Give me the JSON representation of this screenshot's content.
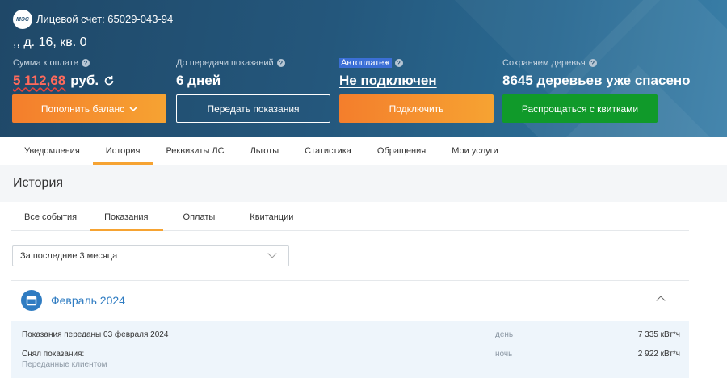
{
  "header": {
    "logo_text": "МЭС",
    "account_label": "Лицевой счет: 65029-043-94",
    "address": ",, д. 16, кв. 0",
    "balance": {
      "label": "Сумма к оплате",
      "amount": "5 112,68",
      "currency": "руб."
    },
    "meter_deadline": {
      "label": "До передачи показаний",
      "value": "6 дней"
    },
    "autopay": {
      "label": "Автоплатеж",
      "value": "Не подключен"
    },
    "trees": {
      "label": "Сохраняем деревья",
      "value": "8645 деревьев уже спасено"
    }
  },
  "buttons": {
    "topup": "Пополнить баланс",
    "submit_readings": "Передать показания",
    "connect": "Подключить",
    "opt_out_receipts": "Распрощаться с квитками"
  },
  "nav": [
    "Уведомления",
    "История",
    "Реквизиты ЛС",
    "Льготы",
    "Статистика",
    "Обращения",
    "Мои услуги"
  ],
  "section": {
    "title": "История"
  },
  "subtabs": [
    "Все события",
    "Показания",
    "Оплаты",
    "Квитанции"
  ],
  "filter": {
    "selected": "За последние 3 месяца"
  },
  "month": {
    "title": "Февраль 2024"
  },
  "entry": {
    "line1": "Показания переданы 03 февраля 2024",
    "line2": "Снял показания:",
    "line3": "Переданные клиентом",
    "rows": [
      {
        "tariff": "день",
        "value": "7 335 кВт*ч"
      },
      {
        "tariff": "ночь",
        "value": "2 922 кВт*ч"
      }
    ]
  },
  "colors": {
    "accent_orange": "#f6a332",
    "green": "#109a2a",
    "link_blue": "#2f7cc2",
    "header_bg": "#24577c"
  }
}
